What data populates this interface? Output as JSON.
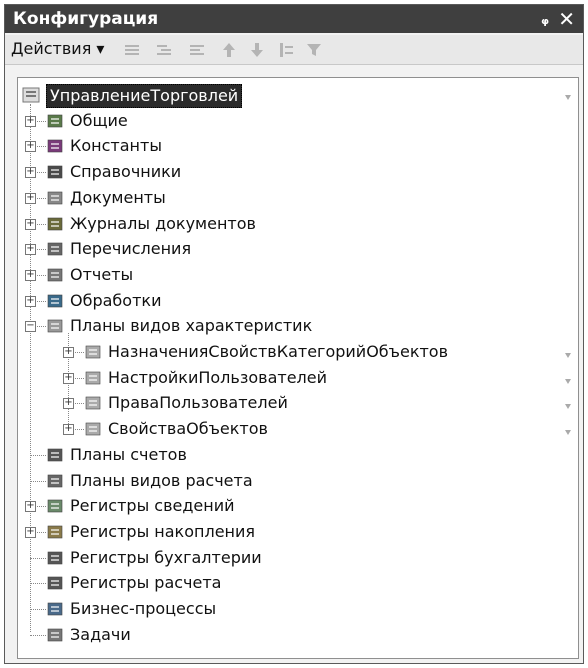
{
  "window": {
    "title": "Конфигурация",
    "pin_icon": "pin-icon",
    "close_icon": "close-icon"
  },
  "toolbar": {
    "actions_label": "Действия ▾"
  },
  "tree": {
    "root": "УправлениеТорговлей",
    "items": [
      {
        "label": "Общие"
      },
      {
        "label": "Константы"
      },
      {
        "label": "Справочники"
      },
      {
        "label": "Документы"
      },
      {
        "label": "Журналы документов"
      },
      {
        "label": "Перечисления"
      },
      {
        "label": "Отчеты"
      },
      {
        "label": "Обработки"
      },
      {
        "label": "Планы видов характеристик"
      },
      {
        "label": "НазначенияСвойствКатегорийОбъектов"
      },
      {
        "label": "НастройкиПользователей"
      },
      {
        "label": "ПраваПользователей"
      },
      {
        "label": "СвойстваОбъектов"
      },
      {
        "label": "Планы счетов"
      },
      {
        "label": "Планы видов расчета"
      },
      {
        "label": "Регистры сведений"
      },
      {
        "label": "Регистры накопления"
      },
      {
        "label": "Регистры бухгалтерии"
      },
      {
        "label": "Регистры расчета"
      },
      {
        "label": "Бизнес-процессы"
      },
      {
        "label": "Задачи"
      }
    ]
  }
}
